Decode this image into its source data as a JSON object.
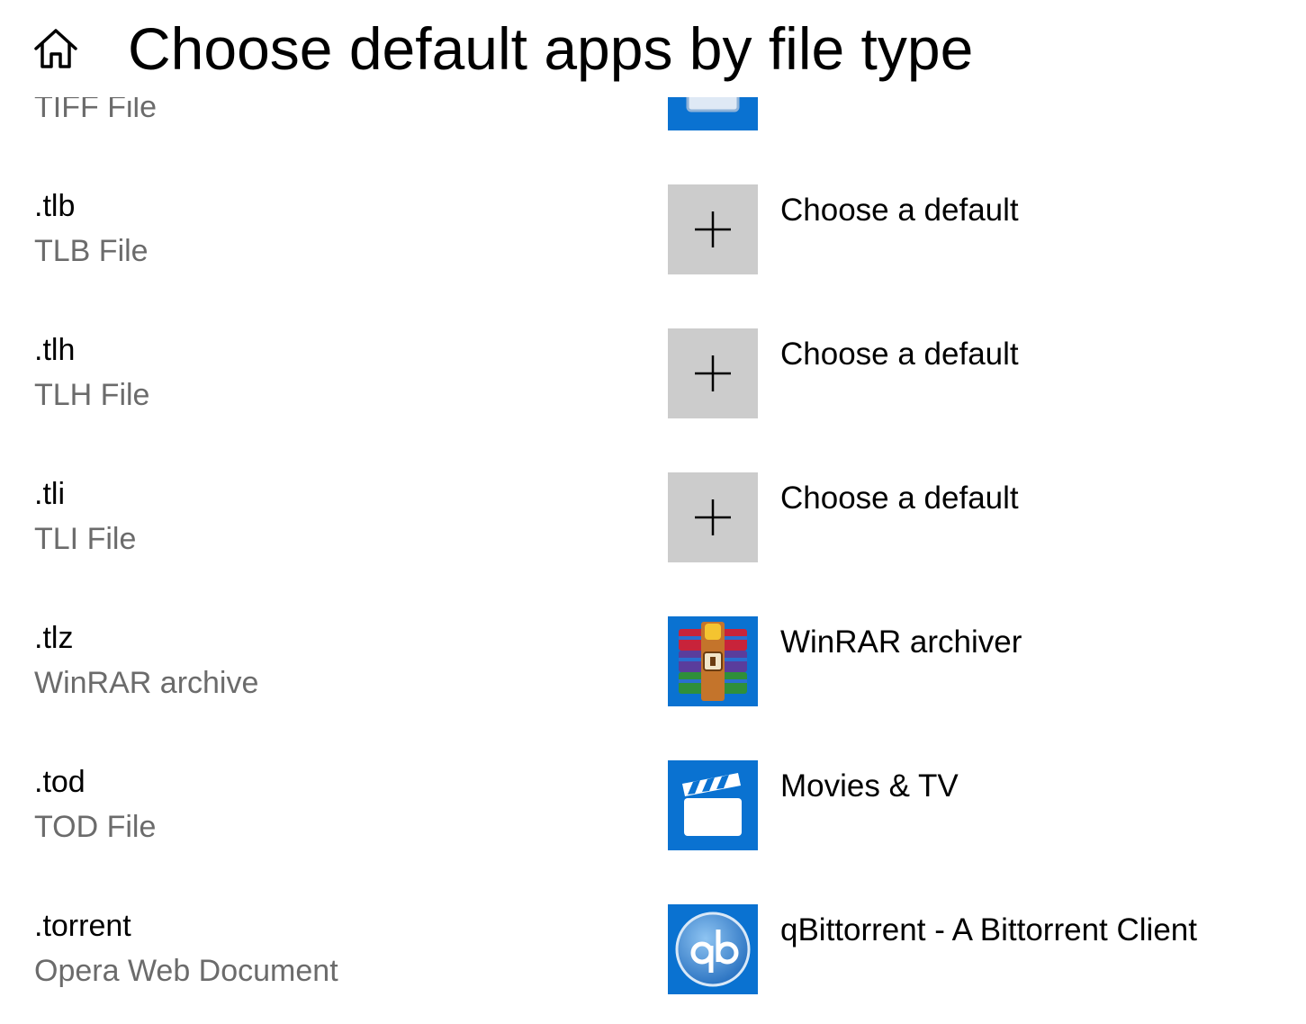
{
  "header": {
    "title": "Choose default apps by file type",
    "home_icon": "home-icon"
  },
  "colors": {
    "accent_tile": "#0a72d1",
    "empty_tile": "#cccccc",
    "secondary_text": "#6b6b6b"
  },
  "rows": [
    {
      "extension": "",
      "description": "TIFF File",
      "app_name": "",
      "icon": "photo-app-icon"
    },
    {
      "extension": ".tlb",
      "description": "TLB File",
      "app_name": "Choose a default",
      "icon": "plus-icon"
    },
    {
      "extension": ".tlh",
      "description": "TLH File",
      "app_name": "Choose a default",
      "icon": "plus-icon"
    },
    {
      "extension": ".tli",
      "description": "TLI File",
      "app_name": "Choose a default",
      "icon": "plus-icon"
    },
    {
      "extension": ".tlz",
      "description": "WinRAR archive",
      "app_name": "WinRAR archiver",
      "icon": "winrar-icon"
    },
    {
      "extension": ".tod",
      "description": "TOD File",
      "app_name": "Movies & TV",
      "icon": "clapperboard-icon"
    },
    {
      "extension": ".torrent",
      "description": "Opera Web Document",
      "app_name": "qBittorrent - A Bittorrent Client",
      "icon": "qbittorrent-icon"
    }
  ]
}
